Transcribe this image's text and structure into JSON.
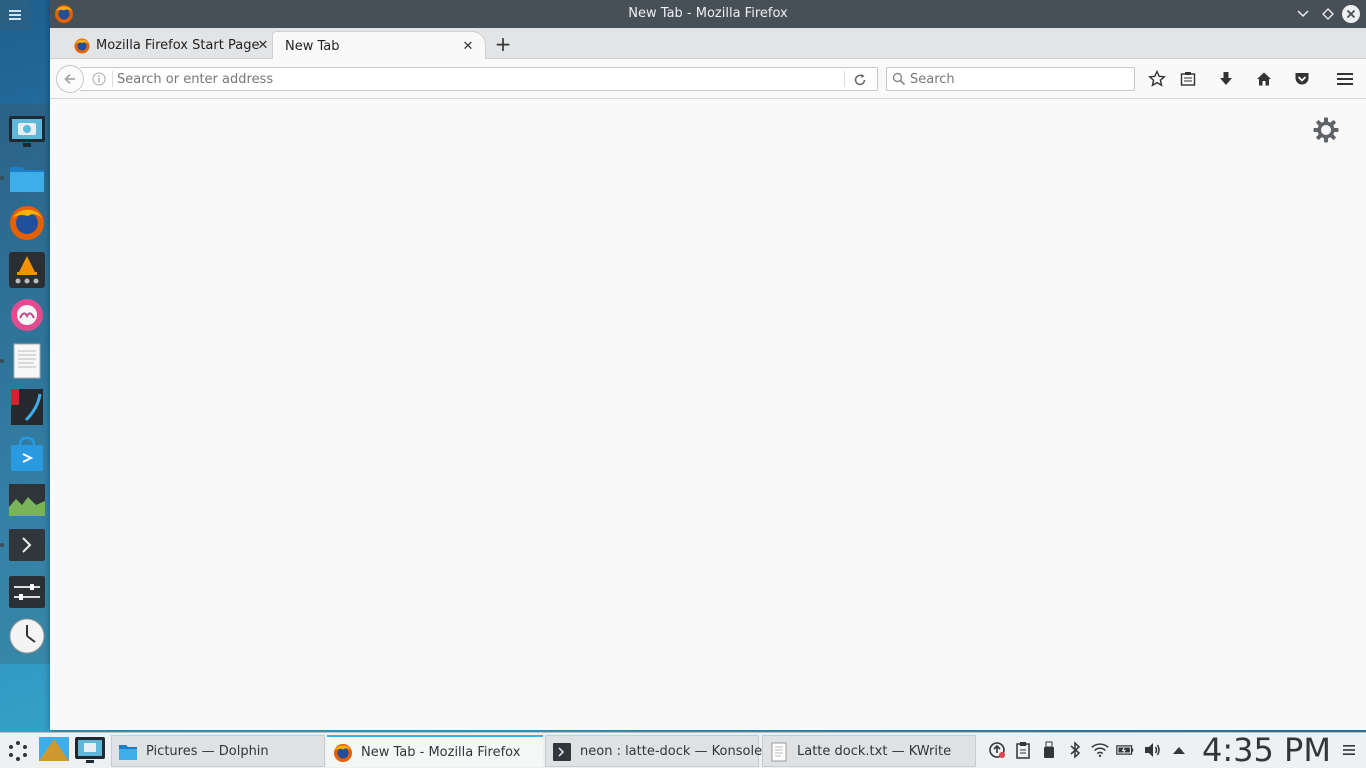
{
  "window": {
    "title": "New Tab - Mozilla Firefox"
  },
  "tabs": [
    {
      "label": "Mozilla Firefox Start Page",
      "active": false
    },
    {
      "label": "New Tab",
      "active": true
    }
  ],
  "toolbar": {
    "url_placeholder": "Search or enter address",
    "search_placeholder": "Search"
  },
  "dock": {
    "items": [
      "screenshot",
      "file-manager",
      "firefox",
      "vlc",
      "music-player",
      "text-editor",
      "krita",
      "app-store",
      "system-monitor",
      "terminal",
      "settings",
      "clock"
    ]
  },
  "taskbar": {
    "tasks": [
      {
        "label": "Pictures — Dolphin",
        "icon": "folder-icon"
      },
      {
        "label": "New Tab - Mozilla Firefox",
        "icon": "firefox-icon",
        "active": true
      },
      {
        "label": "neon : latte-dock — Konsole",
        "icon": "terminal-icon"
      },
      {
        "label": "Latte dock.txt  — KWrite",
        "icon": "text-file-icon"
      }
    ],
    "clock": "4:35 PM"
  },
  "colors": {
    "titlebar": "#475057",
    "accent": "#3daee9",
    "content_bg": "#f9f9f9"
  }
}
